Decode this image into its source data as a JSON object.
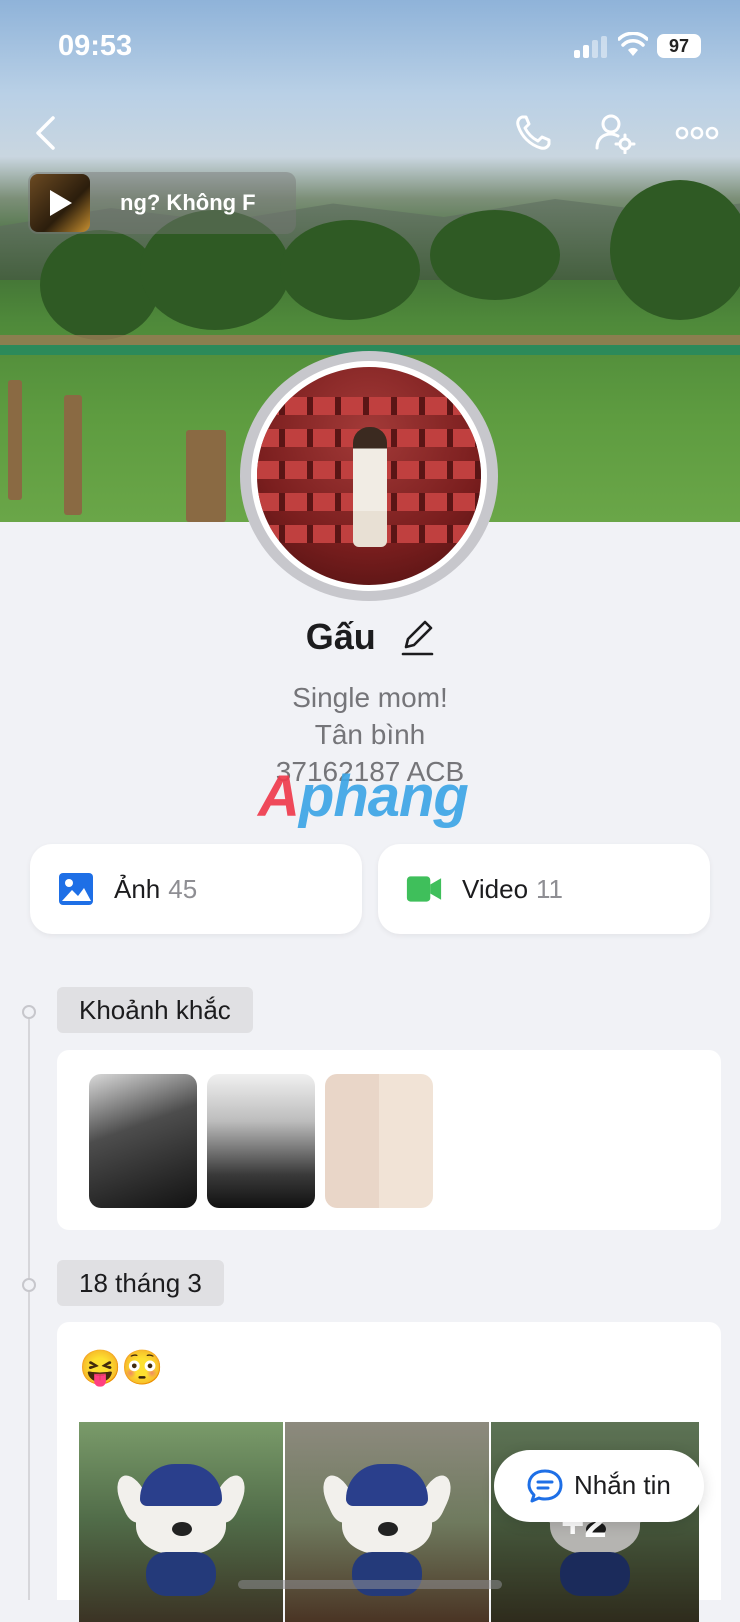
{
  "status_bar": {
    "time": "09:53",
    "battery": "97"
  },
  "music": {
    "text": "ng?       Không F"
  },
  "profile": {
    "name": "Gấu",
    "bio_lines": [
      "Single mom!",
      "Tân bình",
      "37162187 ACB"
    ]
  },
  "watermark": "Aphang",
  "media_cards": [
    {
      "label": "Ảnh",
      "count": "45"
    },
    {
      "label": "Video",
      "count": "11"
    }
  ],
  "sections": [
    {
      "tag": "Khoảnh khắc"
    },
    {
      "tag": "18 tháng 3",
      "post_text": "😝😳",
      "more_count": "+2"
    }
  ],
  "message_button": {
    "label": "Nhắn tin"
  },
  "colors": {
    "accent": "#1e6fe6",
    "video_green": "#3fbf5b",
    "page_bg": "#f1f2f6"
  },
  "icons": [
    "back-icon",
    "phone-icon",
    "user-settings-icon",
    "more-icon",
    "play-icon",
    "edit-icon",
    "image-icon",
    "video-icon",
    "chat-icon"
  ]
}
